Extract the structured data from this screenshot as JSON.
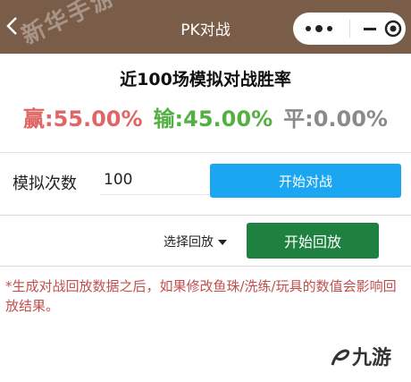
{
  "header": {
    "title": "PK对战",
    "watermark": "新华手游",
    "more_icon": "more-dots-icon",
    "minus_icon": "minus-icon",
    "target_icon": "target-icon"
  },
  "result": {
    "title": "近100场模拟对战胜率",
    "win": "赢:55.00%",
    "lose": "输:45.00%",
    "draw": "平:0.00%"
  },
  "simulate": {
    "label": "模拟次数",
    "count_value": "100",
    "start_button": "开始对战"
  },
  "replay": {
    "select_label": "选择回放",
    "start_button": "开始回放"
  },
  "note": "*生成对战回放数据之后，如果修改鱼珠/洗练/玩具的数值会影响回放结果。",
  "logo": "九游",
  "colors": {
    "header_bg": "#7a5d48",
    "win": "#e06666",
    "lose": "#55b043",
    "draw": "#8a8a8a",
    "battle_button": "#1aa6f0",
    "replay_button": "#1f8140",
    "note": "#c0504d"
  }
}
